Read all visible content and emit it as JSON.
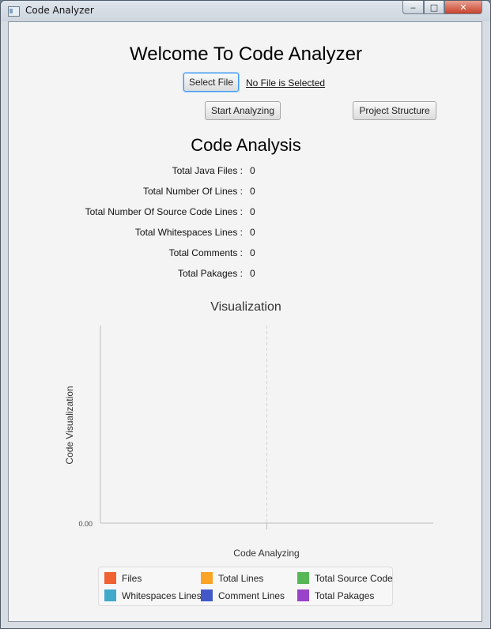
{
  "window": {
    "title": "Code Analyzer",
    "minimize_glyph": "‒",
    "maximize_glyph": "□",
    "close_glyph": "✕"
  },
  "header": {
    "title": "Welcome To Code Analyzer"
  },
  "file": {
    "select_label": "Select File",
    "status": "No File is Selected"
  },
  "actions": {
    "start_label": "Start Analyzing",
    "structure_label": "Project Structure"
  },
  "analysis": {
    "title": "Code Analysis",
    "stats": [
      {
        "label": "Total Java Files :",
        "value": "0"
      },
      {
        "label": "Total Number Of Lines :",
        "value": "0"
      },
      {
        "label": "Total Number Of Source Code Lines :",
        "value": "0"
      },
      {
        "label": "Total Whitespaces Lines :",
        "value": "0"
      },
      {
        "label": "Total Comments :",
        "value": "0"
      },
      {
        "label": "Total Pakages :",
        "value": "0"
      }
    ]
  },
  "chart_data": {
    "type": "bar",
    "title": "Visualization",
    "xlabel": "Code Analyzing",
    "ylabel": "Code Visualization",
    "y_tick_labels": [
      "0.00"
    ],
    "categories": [],
    "series": [
      {
        "name": "Files",
        "color": "#f06232",
        "values": []
      },
      {
        "name": "Total Lines",
        "color": "#f9a423",
        "values": []
      },
      {
        "name": "Total Source Code",
        "color": "#57b757",
        "values": []
      },
      {
        "name": "Whitespaces Lines",
        "color": "#41a9c9",
        "values": []
      },
      {
        "name": "Comment Lines",
        "color": "#4258c9",
        "values": []
      },
      {
        "name": "Total Pakages",
        "color": "#9a42c8",
        "values": []
      }
    ],
    "grid": true,
    "legend_position": "bottom"
  }
}
